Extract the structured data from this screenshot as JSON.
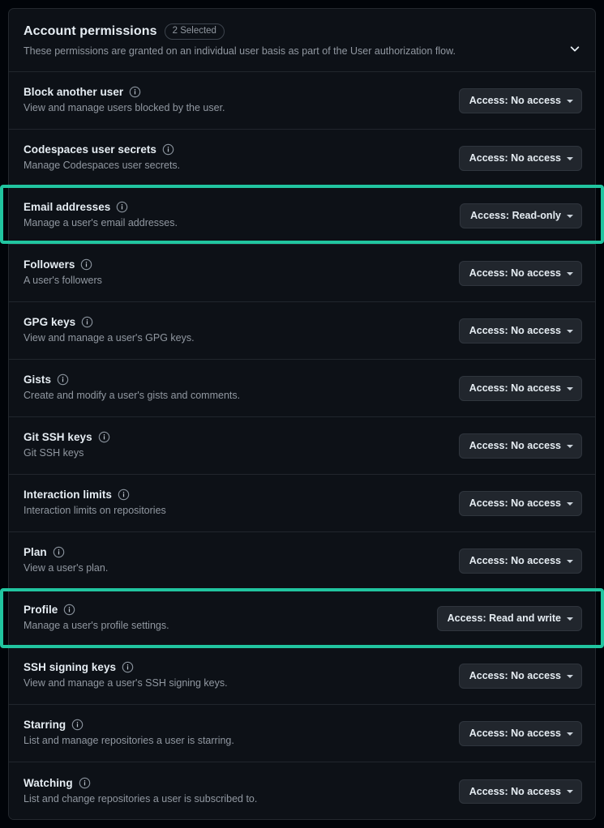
{
  "header": {
    "title": "Account permissions",
    "badge": "2 Selected",
    "description": "These permissions are granted on an individual user basis as part of the User authorization flow.",
    "collapse_icon": "chevron-down-icon"
  },
  "colors": {
    "background": "#010409",
    "panel": "#0d1117",
    "border": "#21262d",
    "title_text": "#e6edf3",
    "muted_text": "#9198a1",
    "button_bg": "#21262d",
    "highlight": "#21c5a0"
  },
  "info_icon_name": "info-icon",
  "permissions": [
    {
      "title": "Block another user",
      "description": "View and manage users blocked by the user.",
      "access_label": "Access: No access",
      "highlighted": false
    },
    {
      "title": "Codespaces user secrets",
      "description": "Manage Codespaces user secrets.",
      "access_label": "Access: No access",
      "highlighted": false
    },
    {
      "title": "Email addresses",
      "description": "Manage a user's email addresses.",
      "access_label": "Access: Read-only",
      "highlighted": true
    },
    {
      "title": "Followers",
      "description": "A user's followers",
      "access_label": "Access: No access",
      "highlighted": false
    },
    {
      "title": "GPG keys",
      "description": "View and manage a user's GPG keys.",
      "access_label": "Access: No access",
      "highlighted": false
    },
    {
      "title": "Gists",
      "description": "Create and modify a user's gists and comments.",
      "access_label": "Access: No access",
      "highlighted": false
    },
    {
      "title": "Git SSH keys",
      "description": "Git SSH keys",
      "access_label": "Access: No access",
      "highlighted": false
    },
    {
      "title": "Interaction limits",
      "description": "Interaction limits on repositories",
      "access_label": "Access: No access",
      "highlighted": false
    },
    {
      "title": "Plan",
      "description": "View a user's plan.",
      "access_label": "Access: No access",
      "highlighted": false
    },
    {
      "title": "Profile",
      "description": "Manage a user's profile settings.",
      "access_label": "Access: Read and write",
      "highlighted": true
    },
    {
      "title": "SSH signing keys",
      "description": "View and manage a user's SSH signing keys.",
      "access_label": "Access: No access",
      "highlighted": false
    },
    {
      "title": "Starring",
      "description": "List and manage repositories a user is starring.",
      "access_label": "Access: No access",
      "highlighted": false
    },
    {
      "title": "Watching",
      "description": "List and change repositories a user is subscribed to.",
      "access_label": "Access: No access",
      "highlighted": false
    }
  ]
}
